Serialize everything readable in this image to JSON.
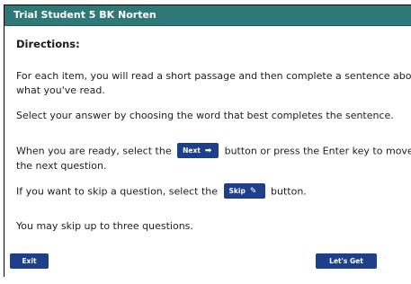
{
  "window": {
    "title": "Trial Student 5 BK Norten"
  },
  "directions": {
    "heading": "Directions:"
  },
  "paragraphs": {
    "p1_line1": "For each item, you will read a short passage and then complete a sentence about",
    "p1_line2": "what you've read.",
    "p2": "Select your answer by choosing the word that best completes the sentence.",
    "p3_before": "When you are ready, select the",
    "p3_after": "button or press the Enter key to move on to",
    "p3_line2": "the next question.",
    "p4_before": "If you want to skip a question, select the",
    "p4_after": "button.",
    "p5": "You may skip up to three questions."
  },
  "inline_buttons": {
    "next_label": "Next",
    "next_icon": "arrow-right-icon",
    "skip_label": "Skip",
    "skip_icon": "pencil-icon"
  },
  "footer": {
    "exit_label": "Exit",
    "start_label": "Let's Get Started"
  },
  "colors": {
    "titlebar": "#2f7878",
    "button": "#1e3f8a"
  }
}
